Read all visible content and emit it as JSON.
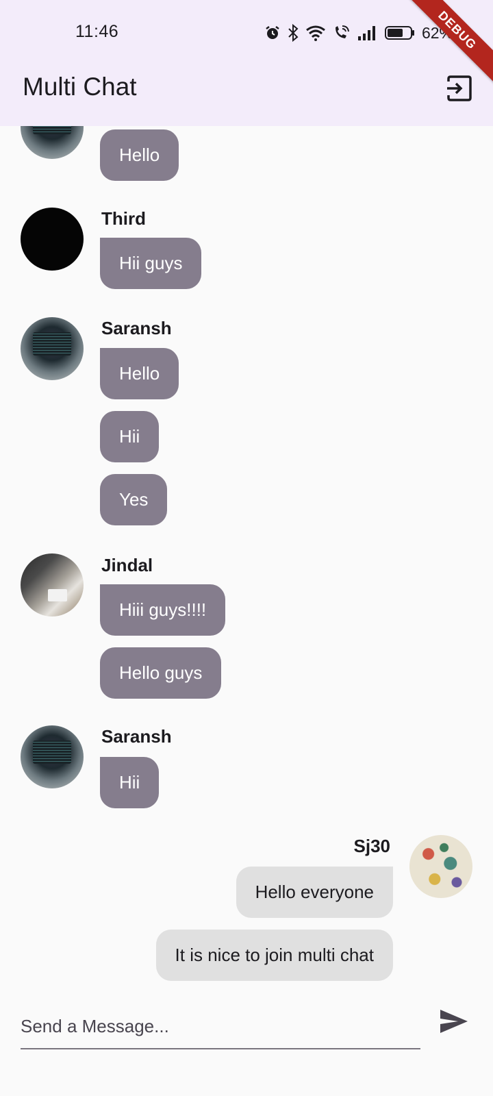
{
  "status_bar": {
    "time": "11:46",
    "battery_percent": "62%",
    "icons": [
      "alarm-icon",
      "bluetooth-icon",
      "wifi-icon",
      "wifi-calling-icon",
      "signal-icon",
      "battery-icon"
    ]
  },
  "debug_banner": "DEBUG",
  "app_bar": {
    "title": "Multi Chat",
    "action_icon": "logout-icon"
  },
  "messages": [
    {
      "sender": "",
      "avatar": "laptop",
      "texts": [
        "Hello"
      ],
      "mine": false
    },
    {
      "sender": "Third",
      "avatar": "black",
      "texts": [
        "Hii guys"
      ],
      "mine": false
    },
    {
      "sender": "Saransh",
      "avatar": "laptop",
      "texts": [
        "Hello",
        "Hii",
        "Yes"
      ],
      "mine": false
    },
    {
      "sender": "Jindal",
      "avatar": "room",
      "texts": [
        "Hiii guys!!!!",
        "Hello guys"
      ],
      "mine": false
    },
    {
      "sender": "Saransh",
      "avatar": "laptop",
      "texts": [
        "Hii"
      ],
      "mine": false
    },
    {
      "sender": "Sj30",
      "avatar": "pattern",
      "texts": [
        "Hello everyone",
        "It is nice to join multi chat"
      ],
      "mine": true
    }
  ],
  "composer": {
    "placeholder": "Send a Message...",
    "value": "",
    "send_icon": "send-icon"
  },
  "colors": {
    "app_bar_bg": "#f3ecfa",
    "incoming_bubble": "#857d8d",
    "outgoing_bubble": "#e0e0e0",
    "debug_ribbon": "#b3261e"
  }
}
